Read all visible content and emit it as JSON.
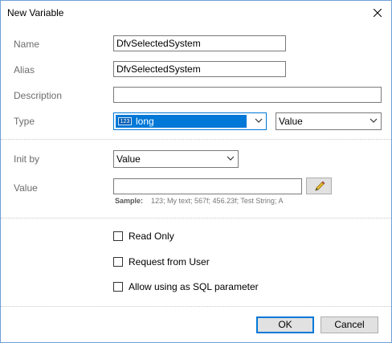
{
  "window": {
    "title": "New Variable"
  },
  "fields": {
    "name_label": "Name",
    "name_value": "DfvSelectedSystem",
    "alias_label": "Alias",
    "alias_value": "DfvSelectedSystem",
    "description_label": "Description",
    "description_value": "",
    "type_label": "Type",
    "type_badge": "123",
    "type_value": "long",
    "type_mode_value": "Value"
  },
  "init": {
    "init_by_label": "Init by",
    "init_by_value": "Value",
    "value_label": "Value",
    "value_value": "",
    "sample_label": "Sample:",
    "sample_text": "123; My text; 567f; 456.23f; Test String; A"
  },
  "options": {
    "read_only": {
      "label": "Read Only",
      "checked": false
    },
    "request_from_user": {
      "label": "Request from User",
      "checked": false
    },
    "allow_sql_parameter": {
      "label": "Allow using as SQL parameter",
      "checked": false
    }
  },
  "buttons": {
    "ok_label": "OK",
    "cancel_label": "Cancel"
  },
  "colors": {
    "selection": "#0078d7",
    "window_border": "#6f9fd8",
    "default_button_border": "#0078d7"
  },
  "icons": {
    "close": "close-icon",
    "edit": "pencil-icon",
    "dropdown": "chevron-down-icon",
    "type": "numeric-type-icon"
  }
}
